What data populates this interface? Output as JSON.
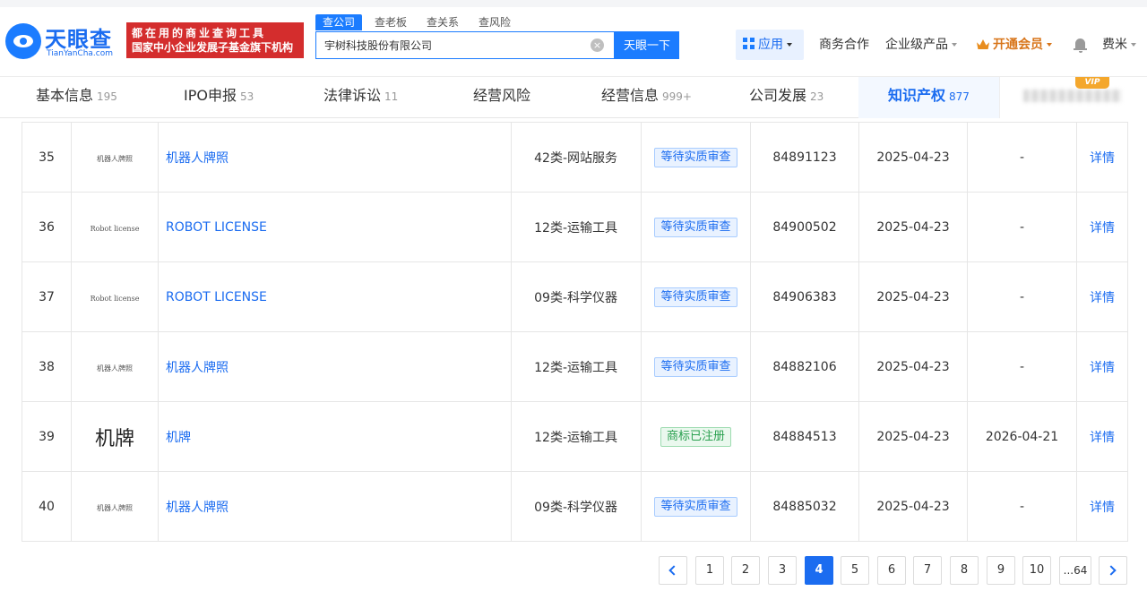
{
  "brand": {
    "name_cn": "天眼查",
    "name_en": "TianYanCha.com",
    "slogan_line1": "都在用的商业查询工具",
    "slogan_line2": "国家中小企业发展子基金旗下机构"
  },
  "search": {
    "tabs": [
      "查公司",
      "查老板",
      "查关系",
      "查风险"
    ],
    "active_tab": 0,
    "value": "宇树科技股份有限公司",
    "button": "天眼一下"
  },
  "topnav": {
    "app": "应用",
    "business": "商务合作",
    "enterprise": "企业级产品",
    "vip": "开通会员",
    "user": "费米"
  },
  "tabs": [
    {
      "label": "基本信息",
      "count": "195"
    },
    {
      "label": "IPO申报",
      "count": "53"
    },
    {
      "label": "法律诉讼",
      "count": "11"
    },
    {
      "label": "经营风险",
      "count": ""
    },
    {
      "label": "经营信息",
      "count": "999+"
    },
    {
      "label": "公司发展",
      "count": "23"
    },
    {
      "label": "知识产权",
      "count": "877",
      "active": true
    }
  ],
  "vip_badge": "VIP",
  "rows": [
    {
      "idx": "35",
      "image_text": "机器人牌照",
      "image_style": "small",
      "name": "机器人牌照",
      "class": "42类-网站服务",
      "status": "等待实质审查",
      "status_type": "wait",
      "reg_no": "84891123",
      "apply_date": "2025-04-23",
      "end_date": "-",
      "action": "详情"
    },
    {
      "idx": "36",
      "image_text": "Robot license",
      "image_style": "small",
      "name": "ROBOT LICENSE",
      "class": "12类-运输工具",
      "status": "等待实质审查",
      "status_type": "wait",
      "reg_no": "84900502",
      "apply_date": "2025-04-23",
      "end_date": "-",
      "action": "详情"
    },
    {
      "idx": "37",
      "image_text": "Robot license",
      "image_style": "small",
      "name": "ROBOT LICENSE",
      "class": "09类-科学仪器",
      "status": "等待实质审查",
      "status_type": "wait",
      "reg_no": "84906383",
      "apply_date": "2025-04-23",
      "end_date": "-",
      "action": "详情"
    },
    {
      "idx": "38",
      "image_text": "机器人牌照",
      "image_style": "small",
      "name": "机器人牌照",
      "class": "12类-运输工具",
      "status": "等待实质审查",
      "status_type": "wait",
      "reg_no": "84882106",
      "apply_date": "2025-04-23",
      "end_date": "-",
      "action": "详情"
    },
    {
      "idx": "39",
      "image_text": "机牌",
      "image_style": "big",
      "name": "机牌",
      "class": "12类-运输工具",
      "status": "商标已注册",
      "status_type": "ok",
      "reg_no": "84884513",
      "apply_date": "2025-04-23",
      "end_date": "2026-04-21",
      "action": "详情"
    },
    {
      "idx": "40",
      "image_text": "机器人牌照",
      "image_style": "small",
      "name": "机器人牌照",
      "class": "09类-科学仪器",
      "status": "等待实质审查",
      "status_type": "wait",
      "reg_no": "84885032",
      "apply_date": "2025-04-23",
      "end_date": "-",
      "action": "详情"
    }
  ],
  "pagination": {
    "pages": [
      "1",
      "2",
      "3",
      "4",
      "5",
      "6",
      "7",
      "8",
      "9",
      "10",
      "...64"
    ],
    "current": "4"
  },
  "colors": {
    "accent": "#1b6cf0",
    "slogan_bg": "#d42d2d",
    "vip": "#d8751a",
    "status_wait": "#1b6cf0",
    "status_ok": "#2aa04f"
  }
}
